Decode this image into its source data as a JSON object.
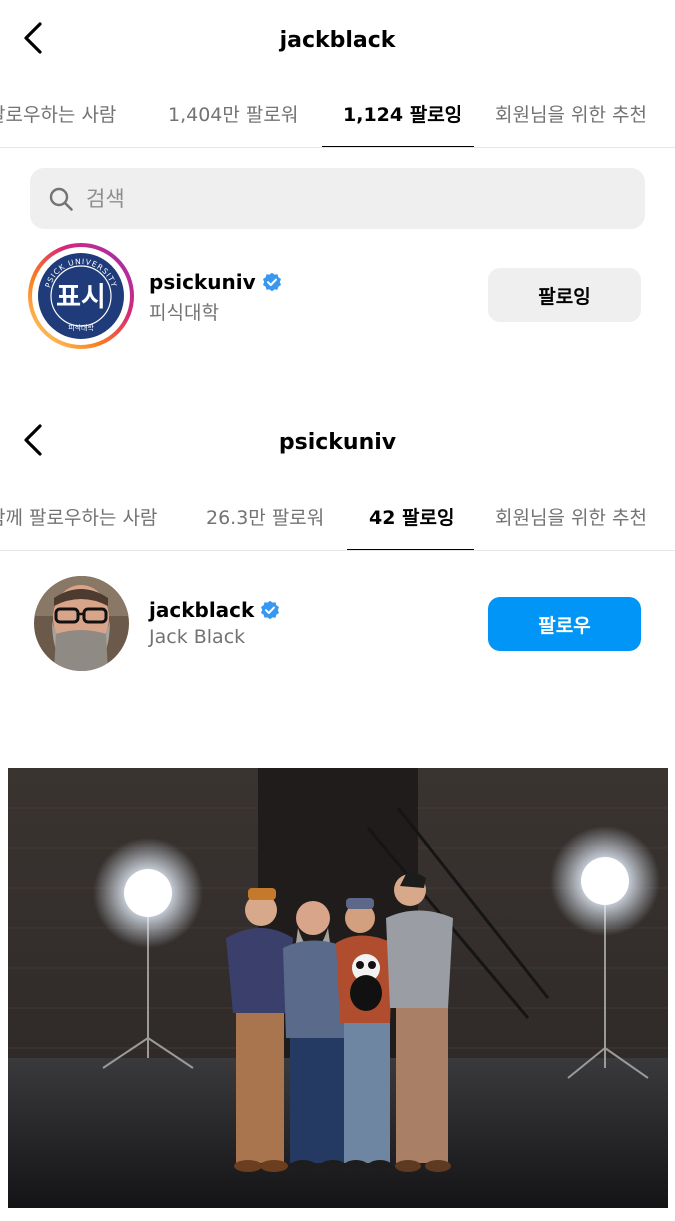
{
  "screen1": {
    "title": "jackblack",
    "tabs": [
      "팔로우하는 사람",
      "1,404만 팔로워",
      "1,124 팔로잉",
      "회원님을 위한 추천"
    ],
    "search_placeholder": "검색",
    "user": {
      "username": "psickuniv",
      "display_name": "피식대학",
      "button_label": "팔로잉",
      "logo_text": "표시",
      "logo_ring_text": "PSICK UNIVERSITY",
      "logo_bottom_text": "피식대학"
    }
  },
  "screen2": {
    "title": "psickuniv",
    "tabs": [
      "함께 팔로우하는 사람",
      "26.3만 팔로워",
      "42 팔로잉",
      "회원님을 위한 추천"
    ],
    "user": {
      "username": "jackblack",
      "display_name": "Jack Black",
      "button_label": "팔로우"
    }
  },
  "colors": {
    "accent_blue": "#0095f6",
    "verified_blue": "#3897f0",
    "logo_navy": "#1f3b7a"
  }
}
